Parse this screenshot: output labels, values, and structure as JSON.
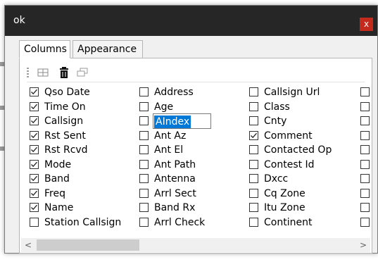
{
  "window": {
    "title": "ok",
    "close_glyph": "x",
    "close_color": "#c42b1c",
    "titlebar_color": "#262626"
  },
  "tabs": [
    {
      "label": "Columns",
      "active": true
    },
    {
      "label": "Appearance",
      "active": false
    }
  ],
  "toolbar": {
    "icons": [
      "grid-icon",
      "trash-icon",
      "window-icon"
    ]
  },
  "columns": {
    "col1": [
      {
        "label": "Qso Date",
        "checked": true
      },
      {
        "label": "Time On",
        "checked": true
      },
      {
        "label": "Callsign",
        "checked": true
      },
      {
        "label": "Rst Sent",
        "checked": true
      },
      {
        "label": "Rst Rcvd",
        "checked": true
      },
      {
        "label": "Mode",
        "checked": true
      },
      {
        "label": "Band",
        "checked": true
      },
      {
        "label": "Freq",
        "checked": true
      },
      {
        "label": "Name",
        "checked": true
      },
      {
        "label": "Station Callsign",
        "checked": false
      }
    ],
    "col2": [
      {
        "label": "Address",
        "checked": false
      },
      {
        "label": "Age",
        "checked": false
      },
      {
        "label": "AIndex",
        "checked": false,
        "editing": true
      },
      {
        "label": "Ant Az",
        "checked": false
      },
      {
        "label": "Ant El",
        "checked": false
      },
      {
        "label": "Ant Path",
        "checked": false
      },
      {
        "label": "Antenna",
        "checked": false
      },
      {
        "label": "Arrl Sect",
        "checked": false
      },
      {
        "label": "Band Rx",
        "checked": false
      },
      {
        "label": "Arrl Check",
        "checked": false
      }
    ],
    "col3": [
      {
        "label": "Callsign Url",
        "checked": false
      },
      {
        "label": "Class",
        "checked": false
      },
      {
        "label": "Cnty",
        "checked": false
      },
      {
        "label": "Comment",
        "checked": true
      },
      {
        "label": "Contacted Op",
        "checked": false
      },
      {
        "label": "Contest Id",
        "checked": false
      },
      {
        "label": "Dxcc",
        "checked": false
      },
      {
        "label": "Cq Zone",
        "checked": false
      },
      {
        "label": "Itu Zone",
        "checked": false
      },
      {
        "label": "Continent",
        "checked": false
      }
    ],
    "col4_count": 10
  },
  "scrollbar": {
    "left_arrow": "<",
    "right_arrow": ">"
  }
}
